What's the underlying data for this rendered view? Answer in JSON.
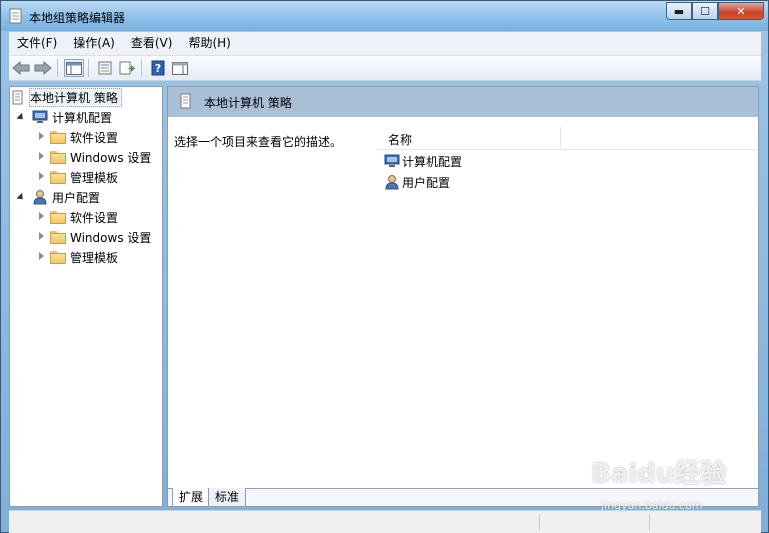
{
  "window": {
    "title": "本地组策略编辑器",
    "minimize": "▬",
    "maximize": "☐",
    "close": "✕"
  },
  "menu": [
    "文件(F)",
    "操作(A)",
    "查看(V)",
    "帮助(H)"
  ],
  "toolbar": {
    "icons": [
      "back-icon",
      "forward-icon",
      "show-hide-tree-icon",
      "properties-icon",
      "export-list-icon",
      "help-icon",
      "show-hide-action-pane-icon"
    ]
  },
  "tree": {
    "root": "本地计算机 策略",
    "computer": {
      "label": "计算机配置",
      "children": [
        "软件设置",
        "Windows 设置",
        "管理模板"
      ]
    },
    "user": {
      "label": "用户配置",
      "children": [
        "软件设置",
        "Windows 设置",
        "管理模板"
      ]
    }
  },
  "right": {
    "header": "本地计算机 策略",
    "description": "选择一个项目来查看它的描述。",
    "column_name": "名称",
    "items": [
      "计算机配置",
      "用户配置"
    ],
    "tabs": [
      "扩展",
      "标准"
    ]
  },
  "watermark": {
    "brand": "Baidu经验",
    "url": "jingyan.baidu.com"
  },
  "colors": {
    "title_bar": "#8ec1ea",
    "header_band": "#a9bfd6",
    "close_button": "#c7432a"
  }
}
